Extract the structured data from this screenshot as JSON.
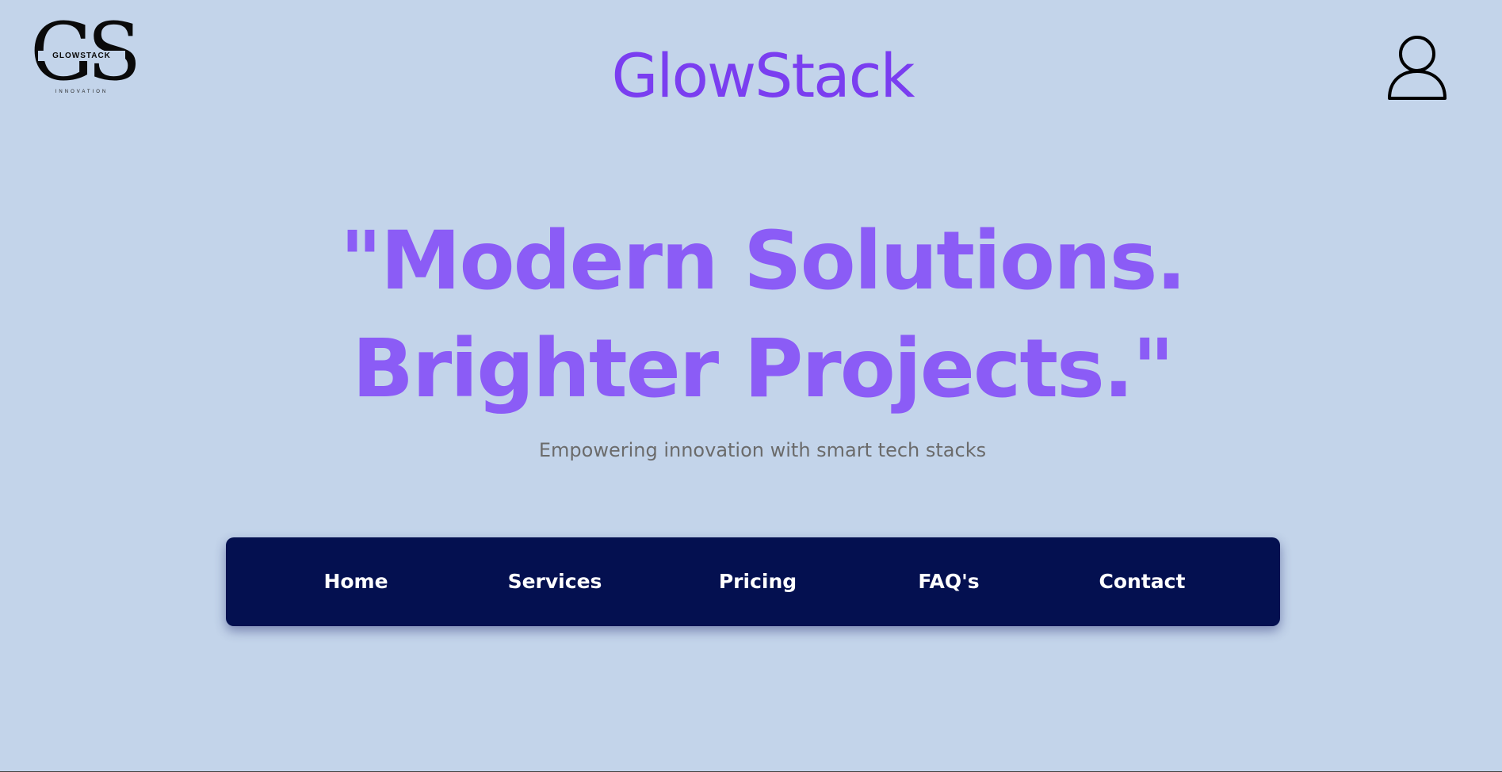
{
  "header": {
    "logo": {
      "monogram": "GS",
      "wordmark": "GLOWSTACK",
      "tagline": "INNOVATION"
    },
    "site_title": "GlowStack",
    "user_icon": "user-icon"
  },
  "hero": {
    "headline_line1": "\"Modern Solutions.",
    "headline_line2": "Brighter Projects.\"",
    "subtitle": "Empowering innovation with smart tech stacks"
  },
  "nav": {
    "items": [
      {
        "label": "Home"
      },
      {
        "label": "Services"
      },
      {
        "label": "Pricing"
      },
      {
        "label": "FAQ's"
      },
      {
        "label": "Contact"
      }
    ]
  },
  "colors": {
    "background": "#c3d4ea",
    "title": "#7a3ef0",
    "headline": "#8b5cf6",
    "subtitle": "#6b6b6b",
    "nav_background": "#041050",
    "nav_text": "#ffffff"
  }
}
